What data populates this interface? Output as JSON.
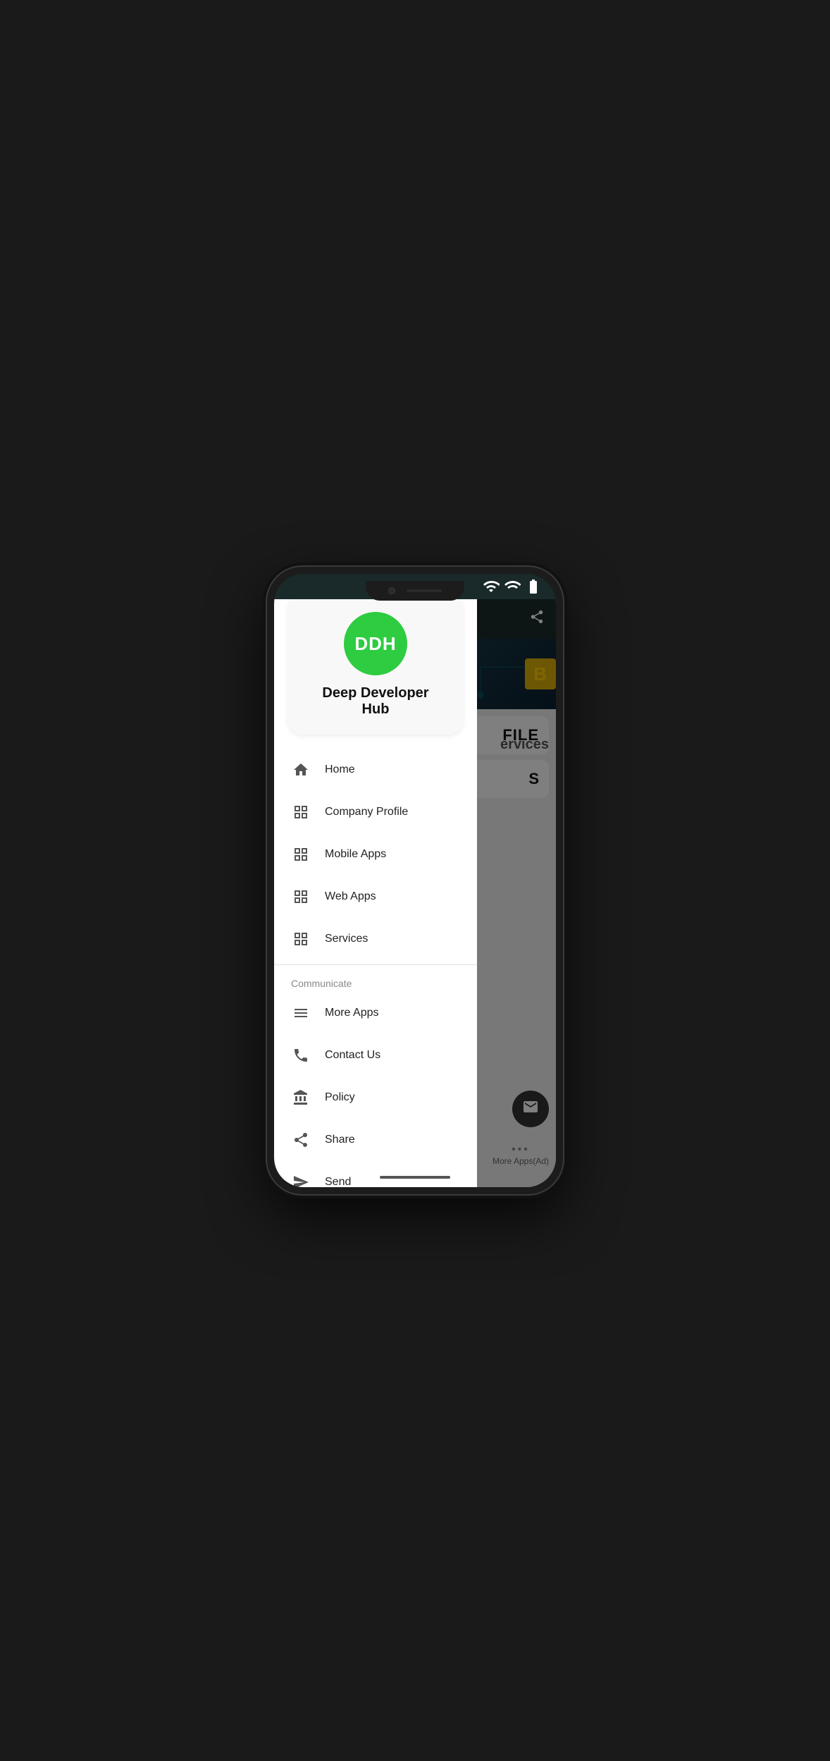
{
  "phone": {
    "status_bar": {
      "wifi": "▼",
      "signal": "▲",
      "battery": "▮"
    },
    "nav_bar_label": "navigation-bar"
  },
  "app": {
    "name": "Deep Developer Hub",
    "logo_initials": "DDH",
    "logo_bg_color": "#2ecc40",
    "background_card1_text": "FILE",
    "background_services_text": "ervices",
    "more_apps_ad": "More Apps(Ad)",
    "share_icon_label": "share"
  },
  "drawer": {
    "logo_initials": "DDH",
    "app_name": "Deep Developer Hub",
    "menu_items": [
      {
        "id": "home",
        "label": "Home",
        "icon": "home"
      },
      {
        "id": "company-profile",
        "label": "Company Profile",
        "icon": "grid"
      },
      {
        "id": "mobile-apps",
        "label": "Mobile Apps",
        "icon": "grid"
      },
      {
        "id": "web-apps",
        "label": "Web Apps",
        "icon": "grid"
      },
      {
        "id": "services",
        "label": "Services",
        "icon": "grid"
      }
    ],
    "section_label": "Communicate",
    "communicate_items": [
      {
        "id": "more-apps",
        "label": "More Apps",
        "icon": "menu"
      },
      {
        "id": "contact-us",
        "label": "Contact Us",
        "icon": "phone"
      },
      {
        "id": "policy",
        "label": "Policy",
        "icon": "bank"
      },
      {
        "id": "share",
        "label": "Share",
        "icon": "share"
      },
      {
        "id": "send",
        "label": "Send",
        "icon": "send"
      }
    ]
  }
}
